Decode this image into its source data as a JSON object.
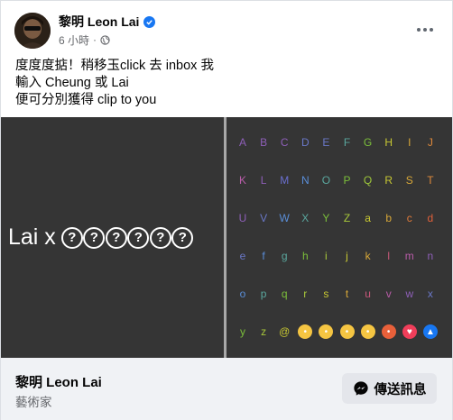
{
  "post": {
    "page_name": "黎明 Leon Lai",
    "verified": true,
    "timestamp": "6 小時",
    "audience_icon": "globe-icon",
    "more_icon": "more-horizontal-icon",
    "text_lines": [
      "度度度掂！稍移玉click 去 inbox 我",
      "輸入 Cheung 或 Lai",
      "便可分別獲得 clip to you"
    ]
  },
  "media": {
    "title_prefix": "Lai x",
    "hidden_chars": [
      "?",
      "?",
      "?",
      "?",
      "?",
      "?"
    ],
    "alphabet_rows": [
      [
        "A",
        "B",
        "C",
        "D",
        "E",
        "F",
        "G",
        "H",
        "I",
        "J"
      ],
      [
        "K",
        "L",
        "M",
        "N",
        "O",
        "P",
        "Q",
        "R",
        "S",
        "T"
      ],
      [
        "U",
        "V",
        "W",
        "X",
        "Y",
        "Z",
        "a",
        "b",
        "c",
        "d"
      ],
      [
        "e",
        "f",
        "g",
        "h",
        "i",
        "j",
        "k",
        "l",
        "m",
        "n"
      ],
      [
        "o",
        "p",
        "q",
        "r",
        "s",
        "t",
        "u",
        "v",
        "w",
        "x"
      ],
      [
        "y",
        "z",
        "@"
      ]
    ],
    "row_colors": [
      [
        "#8e5fb8",
        "#8e5fb8",
        "#8e5fb8",
        "#6a78c8",
        "#6a78c8",
        "#5aa79e",
        "#7bbf3a",
        "#c8c832",
        "#d8a838",
        "#e08a3a"
      ],
      [
        "#b85ca8",
        "#8e5fb8",
        "#6a6fd0",
        "#5a8ed8",
        "#5aa79e",
        "#7bbf3a",
        "#9fc83a",
        "#c8c832",
        "#d8a838",
        "#e08a3a"
      ],
      [
        "#8e5fb8",
        "#6a78c8",
        "#5a8ed8",
        "#5aa79e",
        "#7bbf3a",
        "#a8c83a",
        "#c8c832",
        "#d8a838",
        "#e07a3a",
        "#e0603a"
      ],
      [
        "#6a78c8",
        "#5a8ed8",
        "#5aa79e",
        "#7bbf3a",
        "#a8c83a",
        "#c8c832",
        "#d8a838",
        "#c8587a",
        "#b85ca8",
        "#8e5fb8"
      ],
      [
        "#5a8ed8",
        "#5aa79e",
        "#7bbf3a",
        "#a8c83a",
        "#c8c832",
        "#d8a838",
        "#c8587a",
        "#b85ca8",
        "#8e5fb8",
        "#6a78c8"
      ],
      [
        "#7bbf3a",
        "#a8c83a",
        "#c8c832"
      ]
    ],
    "emojis": [
      {
        "name": "surprised-face-icon",
        "color": "#f5c542"
      },
      {
        "name": "kiss-face-icon",
        "color": "#f5c542"
      },
      {
        "name": "sad-face-icon",
        "color": "#f5c542"
      },
      {
        "name": "laughing-face-icon",
        "color": "#f5c542"
      },
      {
        "name": "angry-face-icon",
        "color": "#e8603a"
      },
      {
        "name": "heart-icon",
        "color": "#f03e5a"
      },
      {
        "name": "thumbs-up-icon",
        "color": "#1877f2"
      }
    ]
  },
  "footer": {
    "page_name": "黎明 Leon Lai",
    "category": "藝術家",
    "send_button_label": "傳送訊息",
    "send_icon": "messenger-icon"
  },
  "colors": {
    "verified_badge": "#1877f2",
    "footer_bg": "#f0f2f5",
    "media_bg": "#353535",
    "button_bg": "#e4e6eb"
  }
}
